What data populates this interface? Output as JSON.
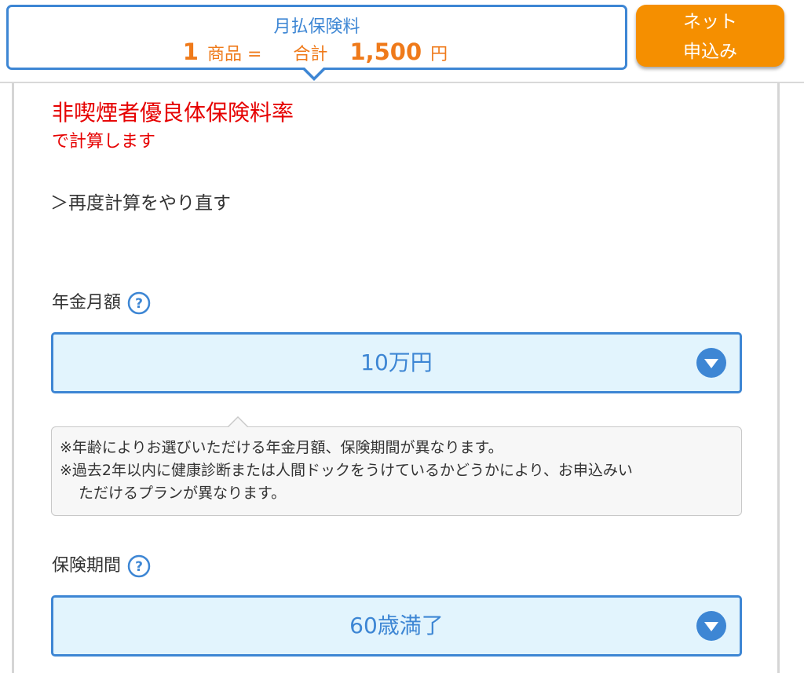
{
  "summary": {
    "title": "月払保険料",
    "count": "1",
    "count_unit": "商品 =",
    "total_label": "合計",
    "total_amount": "1,500",
    "total_unit": "円"
  },
  "apply_button": {
    "line1": "ネット",
    "line2": "申込み"
  },
  "rate_notice": {
    "title": "非喫煙者優良体保険料率",
    "subtitle": "で計算します"
  },
  "redo_link": "＞再度計算をやり直す",
  "pension_monthly": {
    "label": "年金月額",
    "value": "10万円"
  },
  "notes": [
    "※年齢によりお選びいただける年金月額、保険期間が異なります。",
    "※過去2年以内に健康診断または人間ドックをうけているかどうかにより、お申込みい",
    "ただけるプランが異なります。"
  ],
  "insurance_period": {
    "label": "保険期間",
    "value": "60歳満了"
  },
  "colors": {
    "accent_blue": "#3d86d4",
    "orange": "#f58f00",
    "price_orange": "#ef7a1a",
    "alert_red": "#e60000",
    "select_bg": "#e2f4fd"
  },
  "icons": {
    "help": "question-circle-icon",
    "dropdown": "chevron-down-circle-icon"
  }
}
